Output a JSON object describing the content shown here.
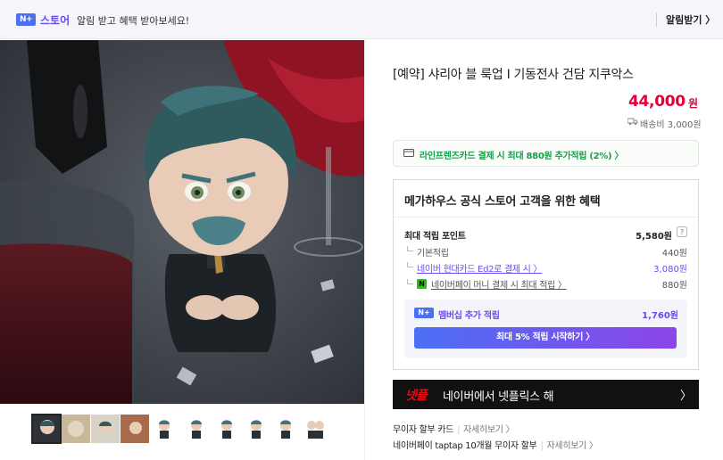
{
  "banner": {
    "npay_badge": "N+",
    "store_word": "스토어",
    "message": "알림 받고 혜택 받아보세요!",
    "alarm_button": "알림받기 〉"
  },
  "product": {
    "title": "[예약] 샤리아 블 룩업 I 기동전사 건담 지쿠악스",
    "price": "44,000",
    "price_unit": "원",
    "shipping": "배송비 3,000원"
  },
  "card_promo": {
    "text": "라인프렌즈카드 결제 시 최대 880원 추가적립 (2%) 〉"
  },
  "benefits": {
    "title": "메가하우스 공식 스토어 고객을 위한 혜택",
    "max_points_label": "최대 적립 포인트",
    "max_points_value": "5,580원",
    "help": "?",
    "rows": [
      {
        "label": "기본적립",
        "value": "440원"
      },
      {
        "label": "네이버 현대카드 Ed2로 결제 시 〉",
        "value": "3,080원"
      },
      {
        "label": "네이버페이 머니 결제 시 최대 적립 〉",
        "value": "880원",
        "badge": "N"
      }
    ],
    "membership_badge": "N+",
    "membership_label": "멤버십 추가 적립",
    "membership_value": "1,760원",
    "membership_button": "최대 5% 적립 시작하기 〉"
  },
  "netflix": {
    "logo": "넷플",
    "text": "네이버에서 넷플릭스 해",
    "arrow": "〉"
  },
  "promos": [
    {
      "label": "무이자 할부 카드",
      "more": "자세히보기 〉"
    },
    {
      "label": "네이버페이 taptap 10개월 무이자 할부",
      "more": "자세히보기 〉"
    }
  ],
  "thumbnails_count": 9,
  "colors": {
    "accent_purple": "#6b49f2",
    "price_red": "#e2003a",
    "npay_green": "#1ec800",
    "card_green": "#14a04a"
  }
}
